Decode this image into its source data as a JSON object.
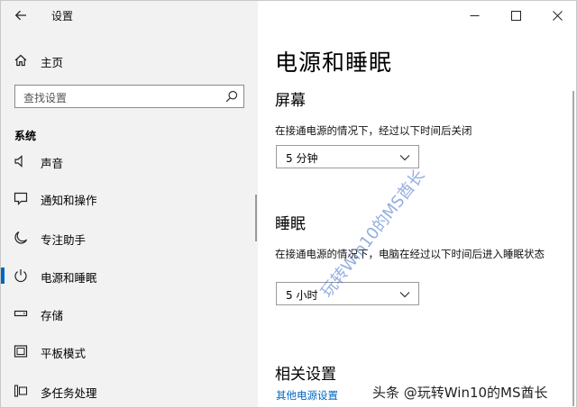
{
  "window": {
    "title": "设置",
    "controls": [
      "minimize-icon",
      "maximize-icon",
      "close-icon"
    ]
  },
  "sidebar": {
    "home_label": "主页",
    "search_placeholder": "查找设置",
    "section_heading": "系统",
    "items": [
      {
        "label": "声音",
        "icon": "speaker-icon",
        "selected": false
      },
      {
        "label": "通知和操作",
        "icon": "notification-icon",
        "selected": false
      },
      {
        "label": "专注助手",
        "icon": "moon-icon",
        "selected": false
      },
      {
        "label": "电源和睡眠",
        "icon": "power-icon",
        "selected": true
      },
      {
        "label": "存储",
        "icon": "storage-icon",
        "selected": false
      },
      {
        "label": "平板模式",
        "icon": "tablet-icon",
        "selected": false
      },
      {
        "label": "多任务处理",
        "icon": "multitask-icon",
        "selected": false
      }
    ]
  },
  "main": {
    "title": "电源和睡眠",
    "screen": {
      "heading": "屏幕",
      "description": "在接通电源的情况下，经过以下时间后关闭",
      "value": "5 分钟"
    },
    "sleep": {
      "heading": "睡眠",
      "description": "在接通电源的情况下，电脑在经过以下时间后进入睡眠状态",
      "value": "5 小时"
    },
    "related": {
      "heading": "相关设置",
      "link": "其他电源设置"
    }
  },
  "watermarks": {
    "diagonal": "玩转Win10的MS酋长",
    "bottom": "头条 @玩转Win10的MS酋长"
  },
  "colors": {
    "accent": "#0067c0",
    "sidebar_bg": "#f2f2f2",
    "main_bg": "#ffffff"
  }
}
